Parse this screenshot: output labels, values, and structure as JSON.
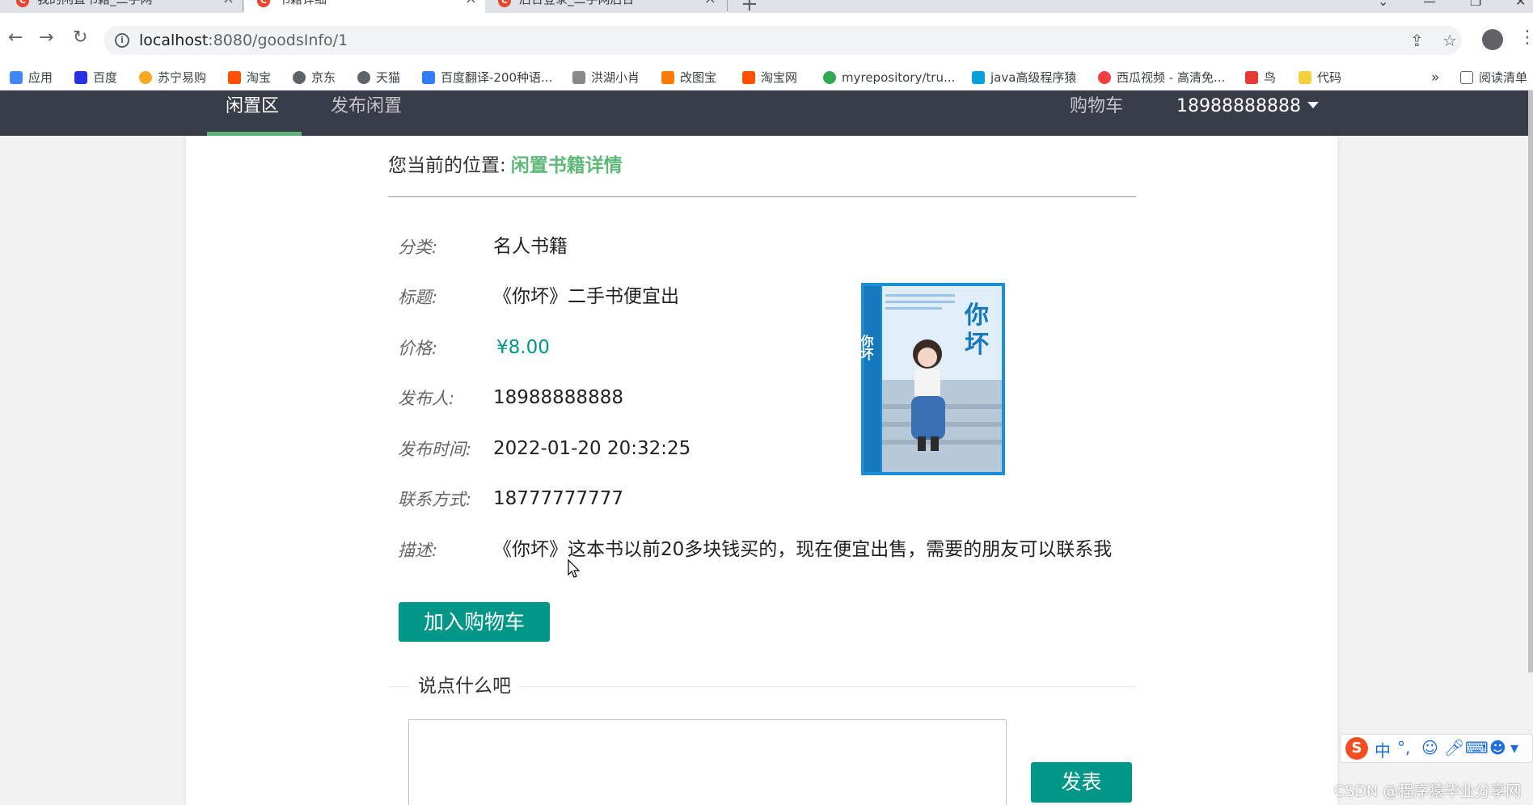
{
  "browser": {
    "tabs": [
      {
        "title": "我的闲置书籍_二手网",
        "active": false
      },
      {
        "title": "书籍详细",
        "active": true
      },
      {
        "title": "后台登录_二手网后台",
        "active": false
      }
    ],
    "url_host": "localhost",
    "url_path": ":8080/goodsInfo/1",
    "bookmarks": [
      {
        "label": "应用",
        "icon": "apps-grid-icon",
        "color": "#4285f4"
      },
      {
        "label": "百度",
        "icon": "baidu-icon",
        "color": "#2932e1"
      },
      {
        "label": "苏宁易购",
        "icon": "suning-icon",
        "color": "#f5a623"
      },
      {
        "label": "淘宝",
        "icon": "taobao-icon",
        "color": "#ff5000"
      },
      {
        "label": "京东",
        "icon": "globe-icon",
        "color": "#5f6368"
      },
      {
        "label": "天猫",
        "icon": "globe-icon",
        "color": "#5f6368"
      },
      {
        "label": "百度翻译-200种语...",
        "icon": "translate-icon",
        "color": "#2f7cf6"
      },
      {
        "label": "洪湖小肖",
        "icon": "feather-icon",
        "color": "#888888"
      },
      {
        "label": "改图宝",
        "icon": "image-edit-icon",
        "color": "#ff7a00"
      },
      {
        "label": "淘宝网",
        "icon": "taobao-icon",
        "color": "#ff5000"
      },
      {
        "label": "myrepository/tru...",
        "icon": "chrome-icon",
        "color": "#34a853"
      },
      {
        "label": "java高级程序猿",
        "icon": "bilibili-icon",
        "color": "#00a1d6"
      },
      {
        "label": "西瓜视频 - 高清免...",
        "icon": "xigua-icon",
        "color": "#f04142"
      },
      {
        "label": "鸟",
        "icon": "bird-icon",
        "color": "#e53935"
      },
      {
        "label": "代码",
        "icon": "folder-icon",
        "color": "#f4d03f"
      }
    ],
    "more": "»",
    "reading_list": "阅读清单"
  },
  "nav": {
    "items": [
      "闲置区",
      "发布闲置"
    ],
    "cart": "购物车",
    "user": "18988888888"
  },
  "breadcrumb": {
    "prefix": "您当前的位置:",
    "current": "闲置书籍详情"
  },
  "details": {
    "category_label": "分类:",
    "category": "名人书籍",
    "title_label": "标题:",
    "title": "《你坏》二手书便宜出",
    "price_label": "价格:",
    "price": "¥8.00",
    "publisher_label": "发布人:",
    "publisher": "18988888888",
    "time_label": "发布时间:",
    "time": "2022-01-20 20:32:25",
    "contact_label": "联系方式:",
    "contact": "18777777777",
    "desc_label": "描述:",
    "desc": "《你坏》这本书以前20多块钱买的，现在便宜出售，需要的朋友可以联系我"
  },
  "book": {
    "cover_title": "你坏"
  },
  "actions": {
    "add_to_cart": "加入购物车"
  },
  "comment": {
    "legend": "说点什么吧",
    "placeholder": "",
    "submit": "发表"
  },
  "ime": {
    "logo": "S",
    "mode": "中"
  },
  "watermark": "CSDN @程序猿毕业分享网",
  "colors": {
    "nav_bg": "#393d49",
    "accent_green": "#5fb878",
    "button_teal": "#009688"
  }
}
